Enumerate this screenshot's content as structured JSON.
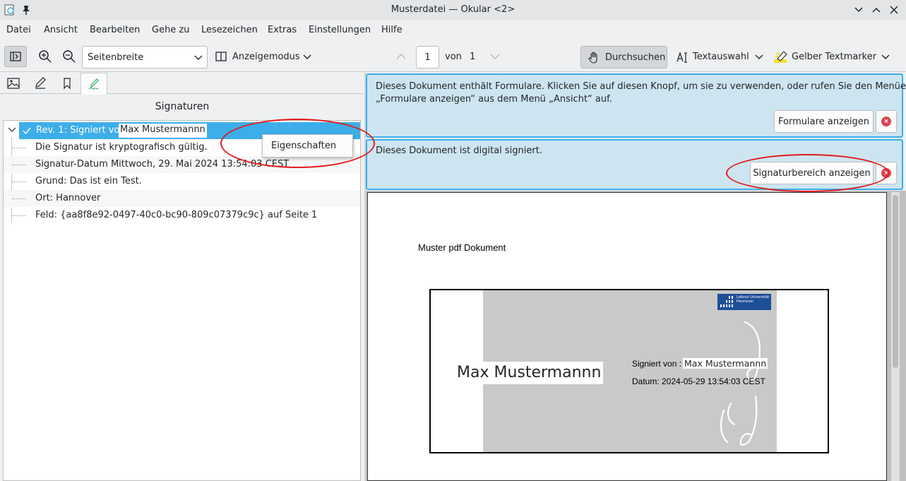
{
  "window": {
    "title": "Musterdatei — Okular <2>"
  },
  "menu": [
    "Datei",
    "Ansicht",
    "Bearbeiten",
    "Gehe zu",
    "Lesezeichen",
    "Extras",
    "Einstellungen",
    "Hilfe"
  ],
  "toolbar": {
    "zoom_mode": "Seitenbreite",
    "view_mode_label": "Anzeigemodus",
    "page_current": "1",
    "page_of_label": "von",
    "page_total": "1",
    "browse_label": "Durchsuchen",
    "text_select_label": "Textauswahl",
    "highlighter_label": "Gelber Textmarker"
  },
  "sidebar": {
    "heading": "Signaturen",
    "signature": {
      "title_prefix": "Rev. 1: Signiert von",
      "signer": "Max Mustermannn",
      "details": [
        "Die Signatur ist kryptografisch gültig.",
        "Signatur-Datum Mittwoch, 29. Mai 2024 13:54:03 CEST",
        "Grund: Das ist ein Test.",
        "Ort: Hannover",
        "Feld: {aa8f8e92-0497-40c0-bc90-809c07379c9c} auf Seite 1"
      ]
    },
    "context_menu": {
      "item": "Eigenschaften"
    }
  },
  "banners": {
    "forms": {
      "text_line1": "Dieses Dokument enthält Formulare. Klicken Sie auf diesen Knopf, um sie zu verwenden, oder rufen Sie den Menüeintrag",
      "text_line2": "„Formulare anzeigen“ aus dem Menü „Ansicht“ auf.",
      "button": "Formulare anzeigen"
    },
    "signed": {
      "text": "Dieses Dokument ist digital signiert.",
      "button": "Signaturbereich anzeigen"
    }
  },
  "document": {
    "heading": "Muster pdf Dokument",
    "stamp": {
      "name": "Max Mustermannn",
      "signed_by_label": "Signiert von :",
      "signed_by_value": "Max Mustermannn",
      "date_line": "Datum: 2024-05-29 13:54:03 CEST",
      "logo_text": "Leibniz Universität Hannover"
    }
  },
  "colors": {
    "accent": "#3daee9",
    "annotation_red": "#e31b1b",
    "banner_bg": "#cde5f0"
  }
}
